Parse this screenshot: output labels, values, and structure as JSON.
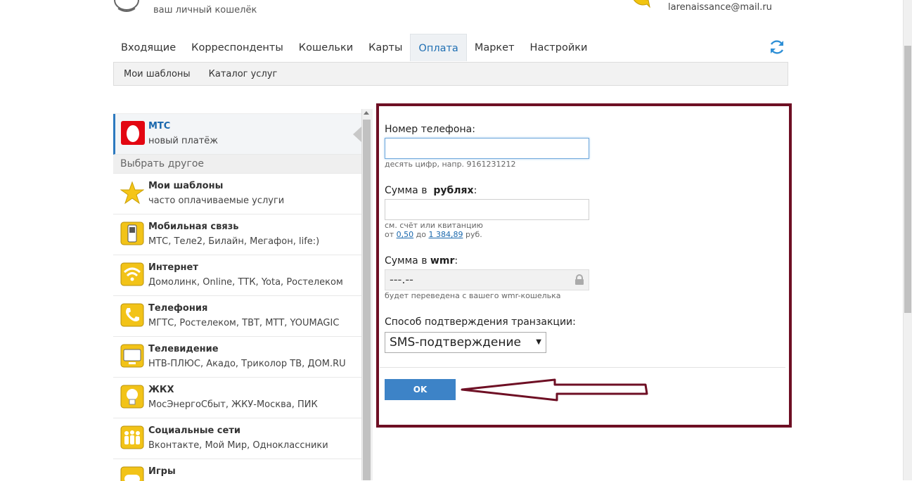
{
  "header": {
    "subtitle": "ваш личный кошелёк",
    "email": "larenaissance@mail.ru"
  },
  "tabs": [
    {
      "label": "Входящие"
    },
    {
      "label": "Корреспонденты"
    },
    {
      "label": "Кошельки"
    },
    {
      "label": "Карты"
    },
    {
      "label": "Оплата",
      "active": true
    },
    {
      "label": "Маркет"
    },
    {
      "label": "Настройки"
    }
  ],
  "subtabs": [
    "Мои шаблоны",
    "Каталог услуг"
  ],
  "sidebar": {
    "selected": {
      "title": "МТС",
      "desc": "новый платёж"
    },
    "choose_other": "Выбрать другое",
    "items": [
      {
        "title": "Мои шаблоны",
        "desc": "часто оплачиваемые услуги",
        "icon": "star-icon"
      },
      {
        "title": "Мобильная связь",
        "desc": "МТС, Теле2, Билайн, Мегафон, life:)",
        "icon": "mobile-phone-icon"
      },
      {
        "title": "Интернет",
        "desc": "Домолинк, Online, ТТК, Yota, Ростелеком",
        "icon": "wifi-icon"
      },
      {
        "title": "Телефония",
        "desc": "МГТС, Ростелеком, ТВТ, МТТ, YOUMAGIC",
        "icon": "handset-icon"
      },
      {
        "title": "Телевидение",
        "desc": "НТВ-ПЛЮС, Акадо, Триколор ТВ, ДОМ.RU",
        "icon": "tv-icon"
      },
      {
        "title": "ЖКХ",
        "desc": "МосЭнергоСбыт, ЖКУ-Москва, ПИК",
        "icon": "lightbulb-icon"
      },
      {
        "title": "Социальные сети",
        "desc": "Вконтакте, Мой Мир, Одноклассники",
        "icon": "people-icon"
      },
      {
        "title": "Игры",
        "desc": "",
        "icon": "gamepad-icon"
      }
    ]
  },
  "form": {
    "phone_label": "Номер телефона:",
    "phone_hint": "десять цифр, напр. 9161231212",
    "sum_rub_label_prefix": "Сумма в",
    "sum_rub_label_bold": "рублях",
    "sum_rub_hint": "см. счёт или квитанцию",
    "range_from": "от",
    "range_min": "0,50",
    "range_to": "до",
    "range_max": "1 384,89",
    "range_unit": "руб.",
    "sum_wmr_label_prefix": "Сумма в",
    "sum_wmr_label_bold": "wmr",
    "sum_wmr_value": "---.--",
    "sum_wmr_hint": "будет переведена с вашего wmr-кошелька",
    "confirm_label": "Способ подтверждения транзакции:",
    "confirm_value": "SMS-подтверждение",
    "ok_label": "OK"
  },
  "colors": {
    "accent": "#3d83c7",
    "frame": "#6e0f24",
    "link": "#1a68ad"
  }
}
